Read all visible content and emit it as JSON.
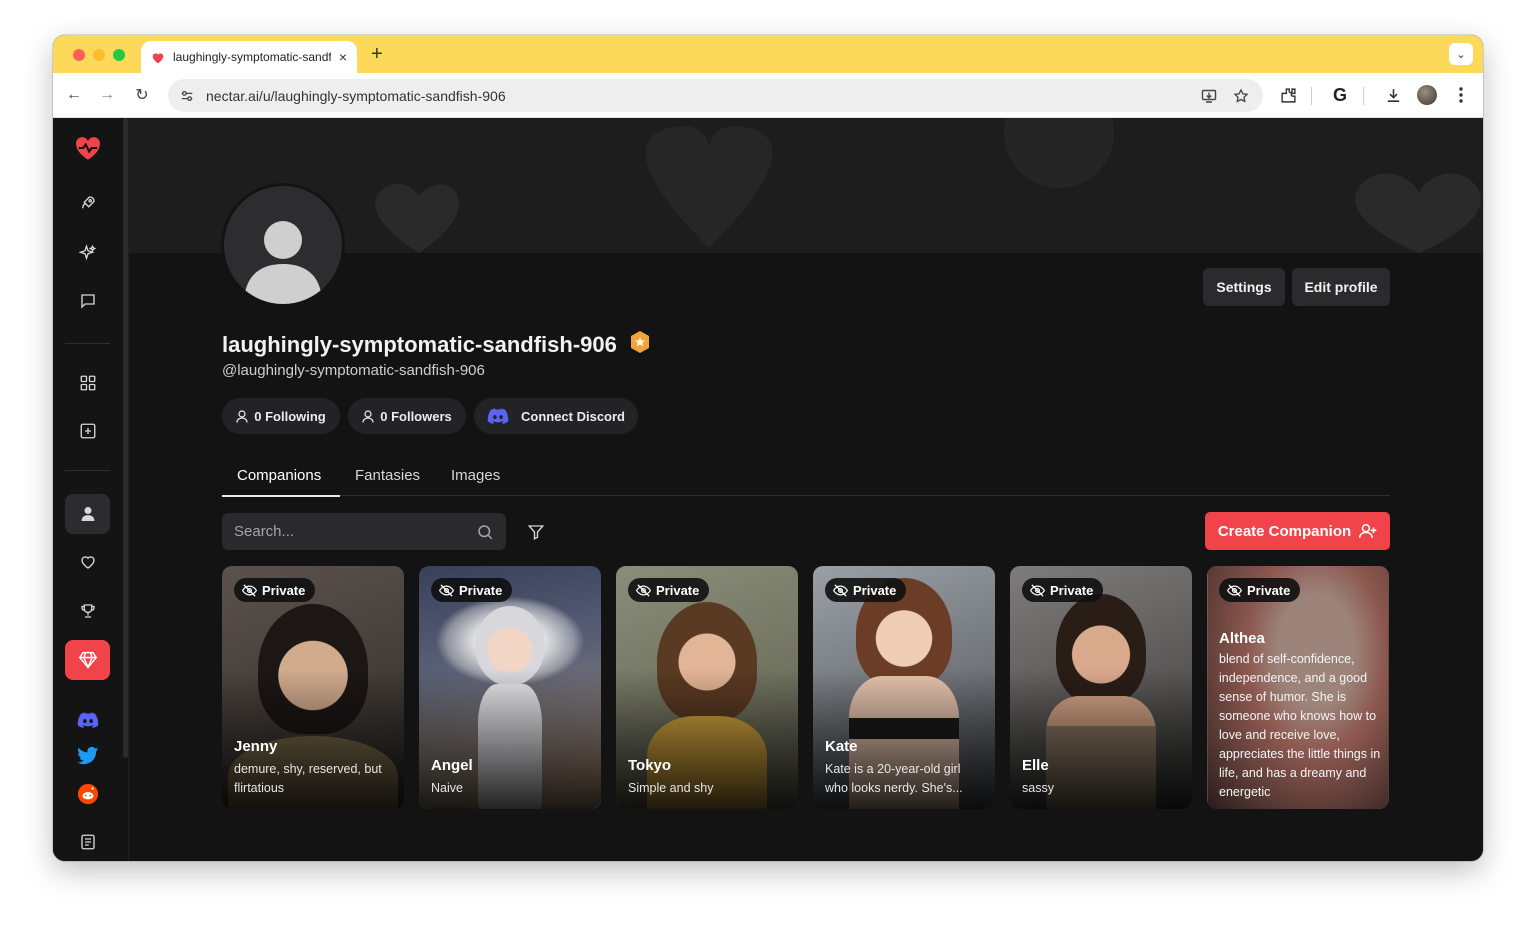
{
  "browser": {
    "tab_title": "laughingly-symptomatic-sandfish-906",
    "tab_close": "×",
    "new_tab": "+",
    "tab_menu": "⌄",
    "url": "nectar.ai/u/laughingly-symptomatic-sandfish-906",
    "back": "←",
    "forward": "→",
    "reload": "↻",
    "google_button": "G"
  },
  "profile": {
    "display_name": "laughingly-symptomatic-sandfish-906",
    "handle": "@laughingly-symptomatic-sandfish-906",
    "following": "0 Following",
    "followers": "0 Followers",
    "connect_discord": "Connect Discord",
    "settings_label": "Settings",
    "edit_profile_label": "Edit profile"
  },
  "tabs": [
    {
      "label": "Companions",
      "active": true
    },
    {
      "label": "Fantasies",
      "active": false
    },
    {
      "label": "Images",
      "active": false
    }
  ],
  "search": {
    "placeholder": "Search..."
  },
  "create_companion_label": "Create Companion",
  "cards": [
    {
      "badge": "Private",
      "name": "Jenny",
      "description": "demure, shy, reserved, but flirtatious"
    },
    {
      "badge": "Private",
      "name": "Angel",
      "description": "Naive"
    },
    {
      "badge": "Private",
      "name": "Tokyo",
      "description": "Simple and shy"
    },
    {
      "badge": "Private",
      "name": "Kate",
      "description": "Kate is a 20-year-old girl who looks nerdy. She's..."
    },
    {
      "badge": "Private",
      "name": "Elle",
      "description": "sassy"
    },
    {
      "badge": "Private",
      "name": "Althea",
      "description": "blend of self-confidence, independence, and a good sense of humor. She is someone who knows how to love and receive love, appreciates the little things in life, and has a dreamy and energetic"
    }
  ],
  "colors": {
    "accent": "#f0444a",
    "tab_strip": "#fcd95a",
    "background": "#131313",
    "discord": "#5865f2"
  }
}
